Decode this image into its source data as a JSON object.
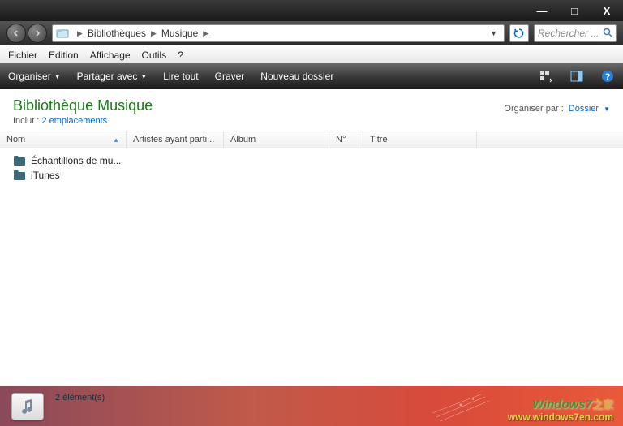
{
  "titlebar": {
    "min": "—",
    "max": "□",
    "close": "X"
  },
  "breadcrumb": {
    "items": [
      "Bibliothèques",
      "Musique"
    ]
  },
  "search": {
    "placeholder": "Rechercher ..."
  },
  "menubar": {
    "items": [
      "Fichier",
      "Edition",
      "Affichage",
      "Outils",
      "?"
    ]
  },
  "toolbar": {
    "organiser": "Organiser",
    "partager": "Partager avec",
    "liretout": "Lire tout",
    "graver": "Graver",
    "nouveau": "Nouveau dossier"
  },
  "library": {
    "title": "Bibliothèque Musique",
    "includes_label": "Inclut :",
    "includes_link": "2 emplacements",
    "arrange_label": "Organiser par :",
    "arrange_value": "Dossier"
  },
  "columns": {
    "nom": "Nom",
    "artistes": "Artistes ayant parti...",
    "album": "Album",
    "no": "N°",
    "titre": "Titre"
  },
  "rows": [
    {
      "name": "Échantillons de mu..."
    },
    {
      "name": "iTunes"
    }
  ],
  "status": {
    "text": "2 élément(s)"
  },
  "watermark": {
    "line1a": "Windows7",
    "line1b": "之家",
    "line2": "www.windows7en.com"
  }
}
